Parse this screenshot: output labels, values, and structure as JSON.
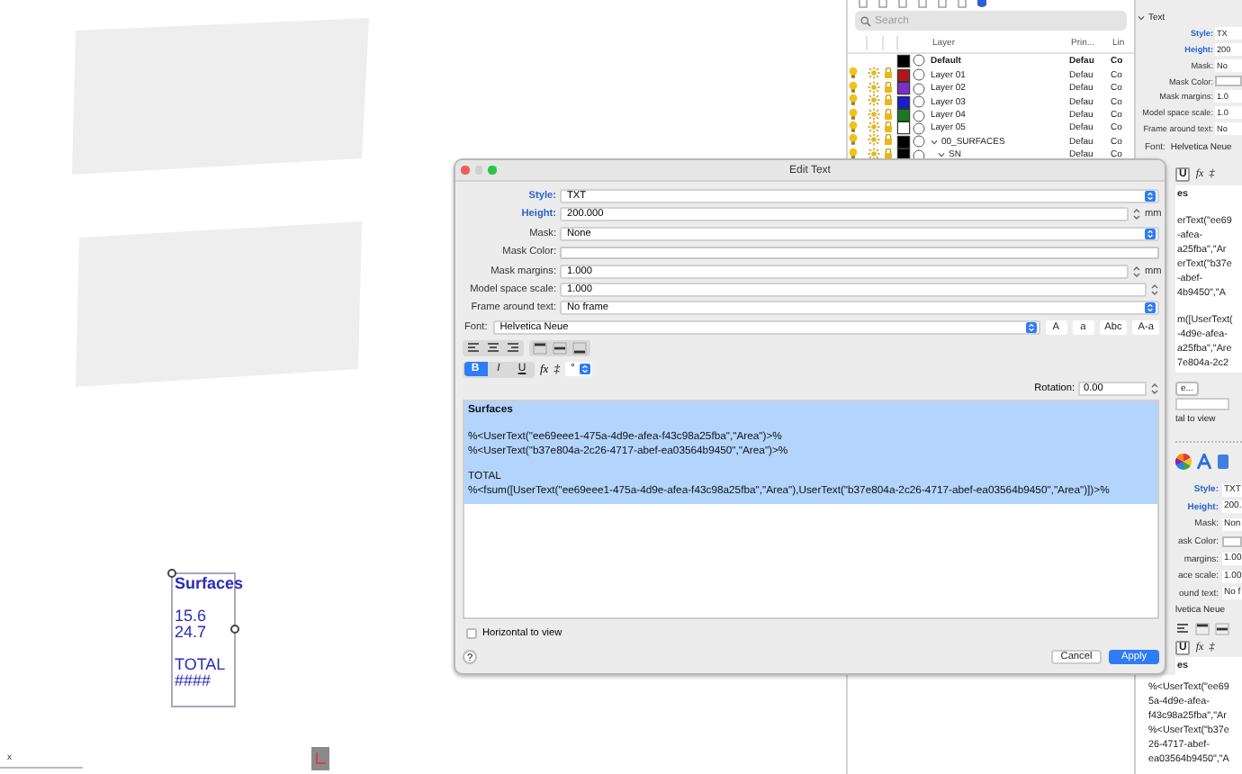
{
  "canvas": {
    "text_block": [
      {
        "text": "Surfaces",
        "bold": true,
        "gap_before": false
      },
      {
        "text": "15.6",
        "bold": false,
        "gap_before": true
      },
      {
        "text": "24.7",
        "bold": false,
        "gap_before": false
      },
      {
        "text": "TOTAL",
        "bold": false,
        "gap_before": true
      },
      {
        "text": "####",
        "bold": false,
        "gap_before": false
      }
    ],
    "axis_label": "x"
  },
  "layers_panel": {
    "search": {
      "placeholder": "Search"
    },
    "columns": [
      "Layer",
      "Prin...",
      "Lin"
    ],
    "layers": [
      {
        "name": "Default",
        "current": true,
        "color": "#000000",
        "print": "Defau",
        "line": "Co"
      },
      {
        "name": "Layer 01",
        "current": false,
        "color": "#b01818",
        "print": "Defau",
        "line": "Co"
      },
      {
        "name": "Layer 02",
        "current": false,
        "color": "#7b2fc8",
        "print": "Defau",
        "line": "Co"
      },
      {
        "name": "Layer 03",
        "current": false,
        "color": "#1c1cc8",
        "print": "Defau",
        "line": "Co"
      },
      {
        "name": "Layer 04",
        "current": false,
        "color": "#1a7a22",
        "print": "Defau",
        "line": "Co"
      },
      {
        "name": "Layer 05",
        "current": false,
        "color": "#ffffff",
        "print": "Defau",
        "line": "Co"
      },
      {
        "name": "00_SURFACES",
        "current": false,
        "color": "#000000",
        "print": "Defau",
        "line": "Co",
        "expanded": true,
        "children": [
          {
            "name": "SN",
            "current": false,
            "color": "#000000",
            "print": "Defau",
            "line": "Co",
            "expanded": true
          }
        ]
      }
    ]
  },
  "properties_panel": {
    "section": "Text",
    "expanded": true,
    "rows": [
      {
        "kind": "value",
        "label": "Style:",
        "value": "TX",
        "accent": true
      },
      {
        "kind": "value",
        "label": "Height:",
        "value": "200",
        "accent": true
      },
      {
        "kind": "value",
        "label": "Mask:",
        "value": "No",
        "accent": false
      },
      {
        "kind": "swatch",
        "label": "Mask Color:",
        "accent": false
      },
      {
        "kind": "value",
        "label": "Mask margins:",
        "value": "1.0",
        "accent": false
      },
      {
        "kind": "value",
        "label": "Model space scale:",
        "value": "1.0",
        "accent": false
      },
      {
        "kind": "value",
        "label": "Frame around text:",
        "value": "No",
        "accent": false
      },
      {
        "kind": "font",
        "label": "Font:",
        "value": "Helvetica Neue",
        "accent": false
      }
    ],
    "under_dialog": [
      {
        "kind": "format-bar",
        "items": [
          "U",
          "fx",
          "‡"
        ]
      },
      {
        "kind": "textarea",
        "lines": [
          {
            "text": "es",
            "bold": true,
            "gap_before": false
          },
          {
            "text": "erText(\"ee69",
            "bold": false,
            "gap_before": true
          },
          {
            "text": "-afea-",
            "bold": false,
            "gap_before": false
          },
          {
            "text": "a25fba\",\"Ar",
            "bold": false,
            "gap_before": false
          },
          {
            "text": "erText(\"b37e",
            "bold": false,
            "gap_before": false
          },
          {
            "text": "-abef-",
            "bold": false,
            "gap_before": false
          },
          {
            "text": "4b9450\",\"A",
            "bold": false,
            "gap_before": false
          },
          {
            "text": "m([UserText(",
            "bold": false,
            "gap_before": true
          },
          {
            "text": "-4d9e-afea-",
            "bold": false,
            "gap_before": false
          },
          {
            "text": "a25fba\",\"Are",
            "bold": false,
            "gap_before": false
          },
          {
            "text": "7e804a-2c2",
            "bold": false,
            "gap_before": false
          }
        ]
      },
      {
        "kind": "button",
        "text": "e..."
      },
      {
        "kind": "field"
      },
      {
        "kind": "caption",
        "text": "tal to view"
      },
      {
        "kind": "icon-bar"
      },
      {
        "kind": "value",
        "label": "Style:",
        "value": "TXT",
        "accent": true
      },
      {
        "kind": "value",
        "label": "Height:",
        "value": "200.",
        "accent": true
      },
      {
        "kind": "value",
        "label": "Mask:",
        "value": "Non",
        "accent": false
      },
      {
        "kind": "swatch",
        "label": "ask Color:",
        "accent": false
      },
      {
        "kind": "value",
        "label": "margins:",
        "value": "1.00",
        "accent": false
      },
      {
        "kind": "value",
        "label": "ace scale:",
        "value": "1.00",
        "accent": false
      },
      {
        "kind": "value",
        "label": "ound text:",
        "value": "No f",
        "accent": false
      },
      {
        "kind": "caption",
        "text": "lvetica Neue"
      },
      {
        "kind": "align-bar"
      },
      {
        "kind": "format-bar",
        "items": [
          "U",
          "fx",
          "‡"
        ]
      },
      {
        "kind": "textarea",
        "lines": [
          {
            "text": "es",
            "bold": true,
            "gap_before": false
          }
        ]
      }
    ],
    "below_dialog": [
      {
        "text": "%<UserText(\"ee69",
        "bold": false,
        "gap_before": false
      },
      {
        "text": "5a-4d9e-afea-",
        "bold": false,
        "gap_before": false
      },
      {
        "text": "f43c98a25fba\",\"Ar",
        "bold": false,
        "gap_before": false
      },
      {
        "text": "%<UserText(\"b37e",
        "bold": false,
        "gap_before": false
      },
      {
        "text": "26-4717-abef-",
        "bold": false,
        "gap_before": false
      },
      {
        "text": "ea03564b9450\",\"A",
        "bold": false,
        "gap_before": false
      }
    ]
  },
  "dialog": {
    "title": "Edit Text",
    "fields": [
      {
        "kind": "select",
        "label": "Style:",
        "value": "TXT",
        "accent": true
      },
      {
        "kind": "number",
        "label": "Height:",
        "value": "200.000",
        "unit": "mm",
        "accent": true
      },
      {
        "kind": "select",
        "label": "Mask:",
        "value": "None",
        "accent": false
      },
      {
        "kind": "color",
        "label": "Mask Color:",
        "accent": false
      },
      {
        "kind": "number",
        "label": "Mask margins:",
        "value": "1.000",
        "unit": "mm",
        "accent": false
      },
      {
        "kind": "number",
        "label": "Model space scale:",
        "value": "1.000",
        "accent": false
      },
      {
        "kind": "select",
        "label": "Frame around text:",
        "value": "No frame",
        "accent": false
      }
    ],
    "font": {
      "label": "Font:",
      "value": "Helvetica Neue",
      "case_buttons": [
        "A",
        "a",
        "Abc",
        "A-a"
      ]
    },
    "style_buttons": [
      {
        "label": "B",
        "selected": true
      },
      {
        "label": "I",
        "selected": false
      },
      {
        "label": "U",
        "selected": false
      }
    ],
    "fx": "fx",
    "stack": "‡",
    "symbol": "°",
    "rotation": {
      "label": "Rotation:",
      "value": "0.00"
    },
    "text": {
      "selected": true,
      "lines": [
        {
          "text": "Surfaces",
          "bold": true,
          "gap_before": false
        },
        {
          "text": "%<UserText(\"ee69eee1-475a-4d9e-afea-f43c98a25fba\",\"Area\")>%",
          "bold": false,
          "gap_before": true
        },
        {
          "text": "%<UserText(\"b37e804a-2c26-4717-abef-ea03564b9450\",\"Area\")>%",
          "bold": false,
          "gap_before": false
        },
        {
          "text": "TOTAL",
          "bold": false,
          "gap_before": true
        },
        {
          "text": "%<fsum([UserText(\"ee69eee1-475a-4d9e-afea-f43c98a25fba\",\"Area\"),UserText(\"b37e804a-2c26-4717-abef-ea03564b9450\",\"Area\")])>%",
          "bold": false,
          "gap_before": false
        }
      ]
    },
    "horizontal": {
      "label": "Horizontal to view",
      "checked": false
    },
    "help": "?",
    "buttons": [
      {
        "label": "Cancel",
        "default": false
      },
      {
        "label": "Apply",
        "default": true
      }
    ]
  }
}
